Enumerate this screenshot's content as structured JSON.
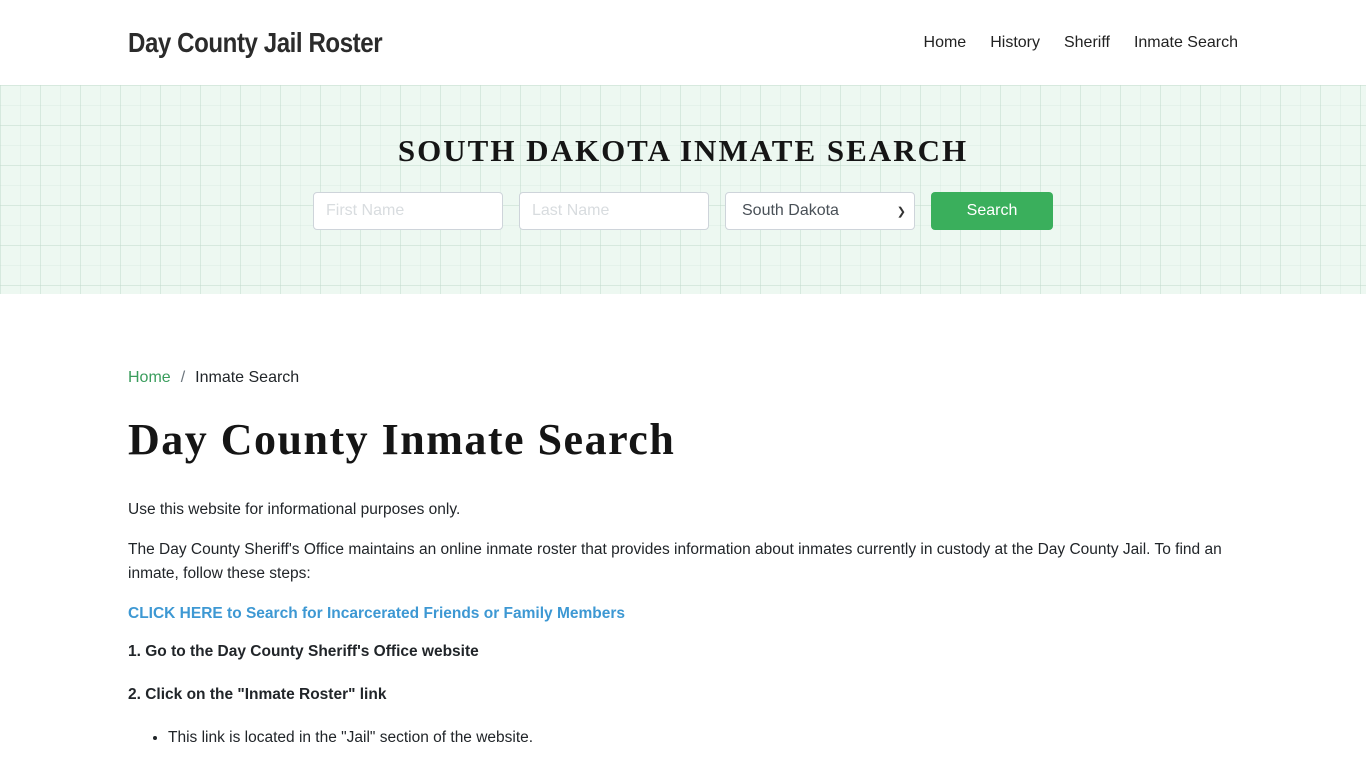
{
  "header": {
    "brand": "Day County Jail Roster",
    "nav": [
      "Home",
      "History",
      "Sheriff",
      "Inmate Search"
    ]
  },
  "hero": {
    "title": "SOUTH DAKOTA INMATE SEARCH",
    "first_name_placeholder": "First Name",
    "last_name_placeholder": "Last Name",
    "state_selected": "South Dakota",
    "search_label": "Search",
    "colors": {
      "button": "#3aaf5c",
      "background": "#edf8f1"
    }
  },
  "breadcrumb": {
    "home": "Home",
    "separator": "/",
    "current": "Inmate Search"
  },
  "main": {
    "title": "Day County Inmate Search",
    "paragraphs": [
      "Use this website for informational purposes only.",
      "The Day County Sheriff's Office maintains an online inmate roster that provides information about inmates currently in custody at the Day County Jail. To find an inmate, follow these steps:"
    ],
    "cta_link": "CLICK HERE to Search for Incarcerated Friends or Family Members",
    "steps": [
      "1. Go to the Day County Sheriff's Office website",
      "2. Click on the \"Inmate Roster\" link"
    ],
    "step2_bullets": [
      "This link is located in the \"Jail\" section of the website."
    ]
  }
}
